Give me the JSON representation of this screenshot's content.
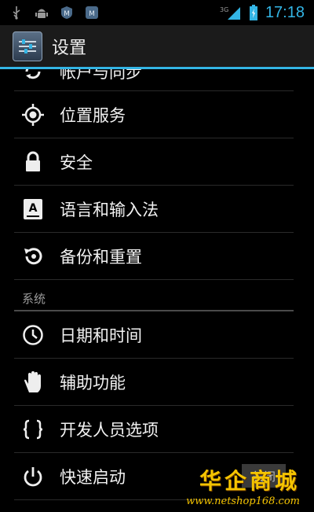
{
  "status_bar": {
    "time": "17:18",
    "network": "3G",
    "icons": [
      "usb-icon",
      "android-debug-icon",
      "notification-m-icon",
      "notification-m2-icon",
      "signal-icon",
      "battery-icon"
    ],
    "clock_color": "#33b5e5"
  },
  "action_bar": {
    "title": "设置",
    "icon": "settings-app-icon",
    "accent": "#33b5e5"
  },
  "list": {
    "partial_item": {
      "label": "帐户与同步",
      "icon": "sync-icon"
    },
    "items_personal": [
      {
        "label": "位置服务",
        "icon": "location-icon"
      },
      {
        "label": "安全",
        "icon": "lock-icon"
      },
      {
        "label": "语言和输入法",
        "icon": "keyboard-a-icon"
      },
      {
        "label": "备份和重置",
        "icon": "backup-icon"
      }
    ],
    "section_system": "系统",
    "items_system": [
      {
        "label": "日期和时间",
        "icon": "clock-icon"
      },
      {
        "label": "辅助功能",
        "icon": "hand-icon"
      },
      {
        "label": "开发人员选项",
        "icon": "braces-icon"
      },
      {
        "label": "快速启动",
        "icon": "power-icon",
        "switch": "关闭"
      }
    ]
  },
  "watermark": {
    "title": "华企商城",
    "url": "www.netshop168.com"
  }
}
